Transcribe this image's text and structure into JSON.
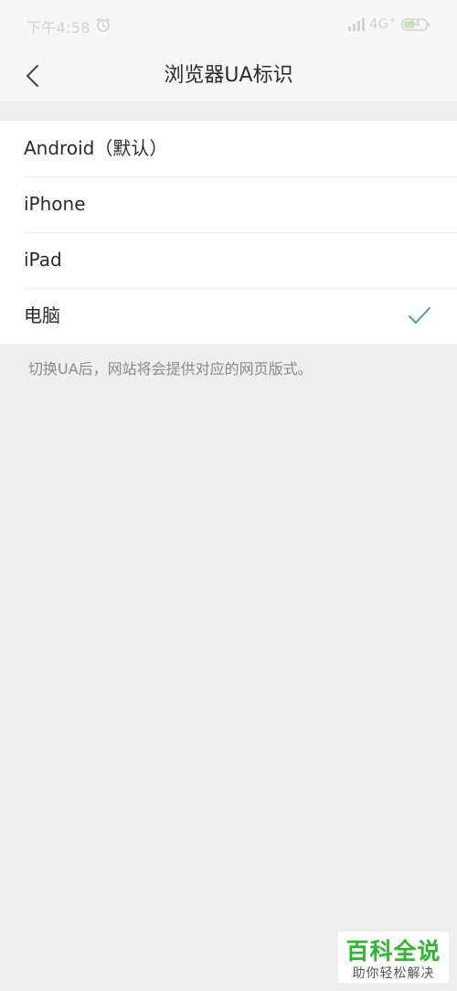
{
  "status_bar": {
    "time": "下午4:58",
    "network": "4G",
    "network_badge": "+",
    "battery": "44",
    "alarm_icon": "alarm-clock-icon",
    "signal_icon": "signal-bars-icon",
    "battery_color": "#b9d9a5"
  },
  "nav": {
    "title": "浏览器UA标识",
    "back_icon": "chevron-left-icon"
  },
  "options": [
    {
      "label": "Android（默认）",
      "selected": false
    },
    {
      "label": "iPhone",
      "selected": false
    },
    {
      "label": "iPad",
      "selected": false
    },
    {
      "label": "电脑",
      "selected": true
    }
  ],
  "check_icon": "checkmark-icon",
  "accent_color": "#4a8fd8",
  "hint": "切换UA后，网站将会提供对应的网页版式。",
  "watermark": {
    "title": "百科全说",
    "subtitle": "助你轻松解决"
  }
}
